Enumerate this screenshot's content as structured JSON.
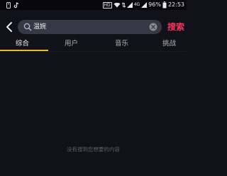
{
  "status_bar": {
    "network_badge": "HD",
    "signal_label": "4G",
    "battery": "96%",
    "time": "22:53"
  },
  "search": {
    "value": "温婉",
    "button_label": "搜索"
  },
  "tabs": [
    {
      "label": "综合",
      "active": true
    },
    {
      "label": "用户",
      "active": false
    },
    {
      "label": "音乐",
      "active": false
    },
    {
      "label": "挑战",
      "active": false
    }
  ],
  "colors": {
    "background": "#111119",
    "search_box": "#383844",
    "accent_red": "#f5355c",
    "tab_indicator": "#e2c020"
  },
  "icons": {
    "back": "chevron-left-icon",
    "search": "search-icon",
    "clear": "clear-icon"
  },
  "empty_state": {
    "message": "没有搜到您想要的内容"
  }
}
